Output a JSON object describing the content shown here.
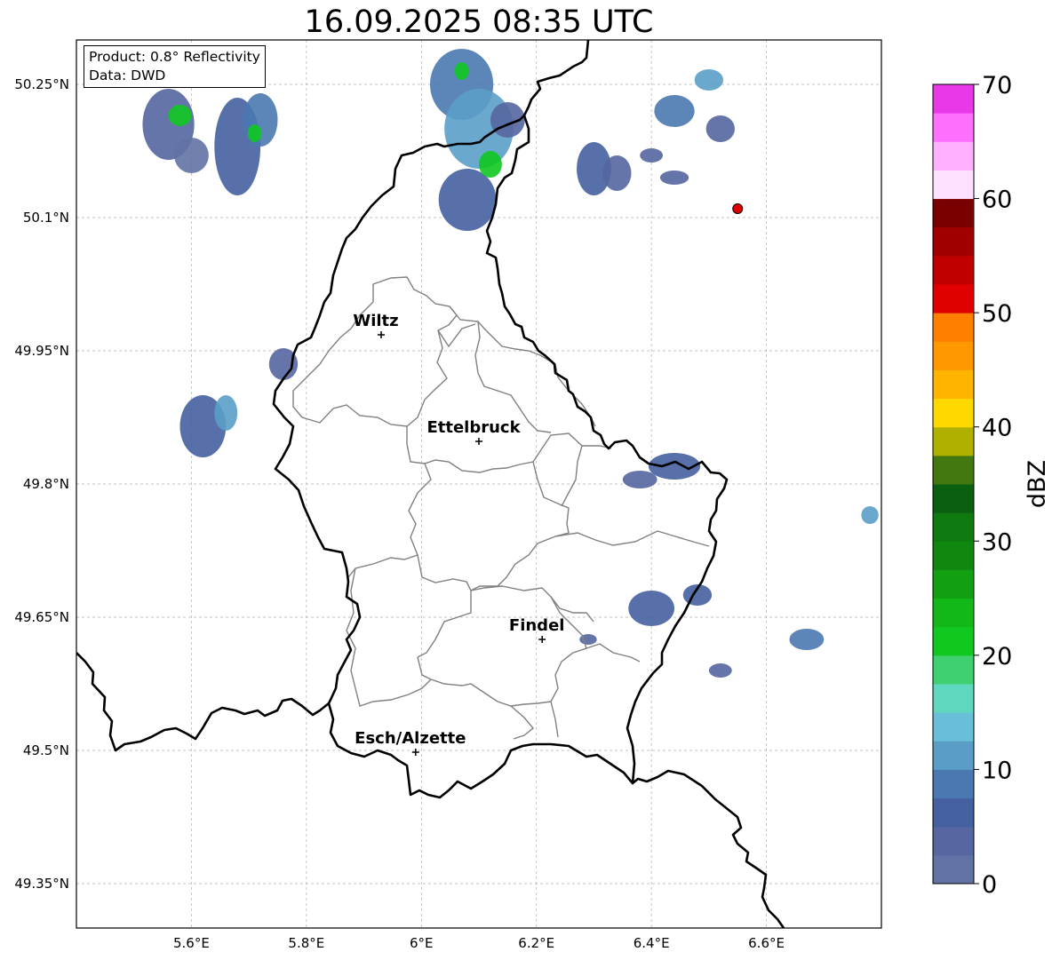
{
  "title": "16.09.2025 08:35 UTC",
  "info_box": {
    "product": "Product: 0.8° Reflectivity",
    "data": "Data: DWD"
  },
  "axes": {
    "x_ticks": [
      {
        "value": 5.6,
        "label": "5.6°E"
      },
      {
        "value": 5.8,
        "label": "5.8°E"
      },
      {
        "value": 6.0,
        "label": "6°E"
      },
      {
        "value": 6.2,
        "label": "6.2°E"
      },
      {
        "value": 6.4,
        "label": "6.4°E"
      },
      {
        "value": 6.6,
        "label": "6.6°E"
      }
    ],
    "y_ticks": [
      {
        "value": 50.25,
        "label": "50.25°N"
      },
      {
        "value": 50.1,
        "label": "50.1°N"
      },
      {
        "value": 49.95,
        "label": "49.95°N"
      },
      {
        "value": 49.8,
        "label": "49.8°N"
      },
      {
        "value": 49.65,
        "label": "49.65°N"
      },
      {
        "value": 49.5,
        "label": "49.5°N"
      },
      {
        "value": 49.35,
        "label": "49.35°N"
      }
    ],
    "lon_range": [
      5.4,
      6.8
    ],
    "lat_range": [
      49.3,
      50.3
    ],
    "grid": true
  },
  "cities": [
    {
      "name": "Wiltz",
      "lon": 5.93,
      "lat": 49.968
    },
    {
      "name": "Ettelbruck",
      "lon": 6.1,
      "lat": 49.848
    },
    {
      "name": "Findel",
      "lon": 6.21,
      "lat": 49.625
    },
    {
      "name": "Esch/Alzette",
      "lon": 5.99,
      "lat": 49.498
    }
  ],
  "radar_site": {
    "lon": 6.55,
    "lat": 50.11,
    "color": "#e00000"
  },
  "colorbar": {
    "label": "dBZ",
    "min": 0,
    "max": 70,
    "ticks": [
      0,
      10,
      20,
      30,
      40,
      50,
      60,
      70
    ],
    "tick_labels": [
      "0",
      "10",
      "20",
      "30",
      "40",
      "50",
      "60",
      "70"
    ],
    "colors": [
      "#6272a4",
      "#5566a0",
      "#4560a0",
      "#4a78b0",
      "#5a9ec8",
      "#68c0d8",
      "#60d8c0",
      "#40d070",
      "#10c820",
      "#12b818",
      "#12a012",
      "#108810",
      "#0e7a10",
      "#0a6010",
      "#437810",
      "#b0b000",
      "#ffd800",
      "#ffb400",
      "#ff9800",
      "#ff8000",
      "#e00000",
      "#c00000",
      "#a00000",
      "#780000",
      "#ffe0ff",
      "#ffb0ff",
      "#ff70ff",
      "#e838e8"
    ]
  },
  "echo_cells": [
    {
      "lon": 5.56,
      "lat": 50.205,
      "rx": 0.045,
      "ry": 0.04,
      "dbz": 3
    },
    {
      "lon": 5.58,
      "lat": 50.215,
      "rx": 0.02,
      "ry": 0.012,
      "dbz": 20
    },
    {
      "lon": 5.68,
      "lat": 50.18,
      "rx": 0.04,
      "ry": 0.055,
      "dbz": 5
    },
    {
      "lon": 5.72,
      "lat": 50.21,
      "rx": 0.03,
      "ry": 0.03,
      "dbz": 8
    },
    {
      "lon": 5.71,
      "lat": 50.195,
      "rx": 0.012,
      "ry": 0.01,
      "dbz": 22
    },
    {
      "lon": 5.6,
      "lat": 50.17,
      "rx": 0.03,
      "ry": 0.02,
      "dbz": 2
    },
    {
      "lon": 6.07,
      "lat": 50.25,
      "rx": 0.055,
      "ry": 0.04,
      "dbz": 8
    },
    {
      "lon": 6.1,
      "lat": 50.2,
      "rx": 0.06,
      "ry": 0.045,
      "dbz": 10
    },
    {
      "lon": 6.08,
      "lat": 50.12,
      "rx": 0.05,
      "ry": 0.035,
      "dbz": 5
    },
    {
      "lon": 6.12,
      "lat": 50.16,
      "rx": 0.02,
      "ry": 0.015,
      "dbz": 22
    },
    {
      "lon": 6.07,
      "lat": 50.265,
      "rx": 0.012,
      "ry": 0.01,
      "dbz": 20
    },
    {
      "lon": 6.15,
      "lat": 50.21,
      "rx": 0.03,
      "ry": 0.02,
      "dbz": 3
    },
    {
      "lon": 6.3,
      "lat": 50.155,
      "rx": 0.03,
      "ry": 0.03,
      "dbz": 5
    },
    {
      "lon": 6.34,
      "lat": 50.15,
      "rx": 0.025,
      "ry": 0.02,
      "dbz": 3
    },
    {
      "lon": 6.44,
      "lat": 50.22,
      "rx": 0.035,
      "ry": 0.018,
      "dbz": 8
    },
    {
      "lon": 6.5,
      "lat": 50.255,
      "rx": 0.025,
      "ry": 0.012,
      "dbz": 10
    },
    {
      "lon": 6.52,
      "lat": 50.2,
      "rx": 0.025,
      "ry": 0.015,
      "dbz": 4
    },
    {
      "lon": 6.44,
      "lat": 50.145,
      "rx": 0.025,
      "ry": 0.008,
      "dbz": 3
    },
    {
      "lon": 6.4,
      "lat": 50.17,
      "rx": 0.02,
      "ry": 0.008,
      "dbz": 4
    },
    {
      "lon": 5.62,
      "lat": 49.865,
      "rx": 0.04,
      "ry": 0.035,
      "dbz": 6
    },
    {
      "lon": 5.66,
      "lat": 49.88,
      "rx": 0.02,
      "ry": 0.02,
      "dbz": 12
    },
    {
      "lon": 5.76,
      "lat": 49.935,
      "rx": 0.025,
      "ry": 0.018,
      "dbz": 4
    },
    {
      "lon": 6.44,
      "lat": 49.82,
      "rx": 0.045,
      "ry": 0.015,
      "dbz": 6
    },
    {
      "lon": 6.38,
      "lat": 49.805,
      "rx": 0.03,
      "ry": 0.01,
      "dbz": 4
    },
    {
      "lon": 6.4,
      "lat": 49.66,
      "rx": 0.04,
      "ry": 0.02,
      "dbz": 7
    },
    {
      "lon": 6.48,
      "lat": 49.675,
      "rx": 0.025,
      "ry": 0.012,
      "dbz": 5
    },
    {
      "lon": 6.67,
      "lat": 49.625,
      "rx": 0.03,
      "ry": 0.012,
      "dbz": 8
    },
    {
      "lon": 6.52,
      "lat": 49.59,
      "rx": 0.02,
      "ry": 0.008,
      "dbz": 3
    },
    {
      "lon": 6.78,
      "lat": 49.765,
      "rx": 0.015,
      "ry": 0.01,
      "dbz": 12
    },
    {
      "lon": 6.29,
      "lat": 49.625,
      "rx": 0.015,
      "ry": 0.006,
      "dbz": 3
    }
  ]
}
